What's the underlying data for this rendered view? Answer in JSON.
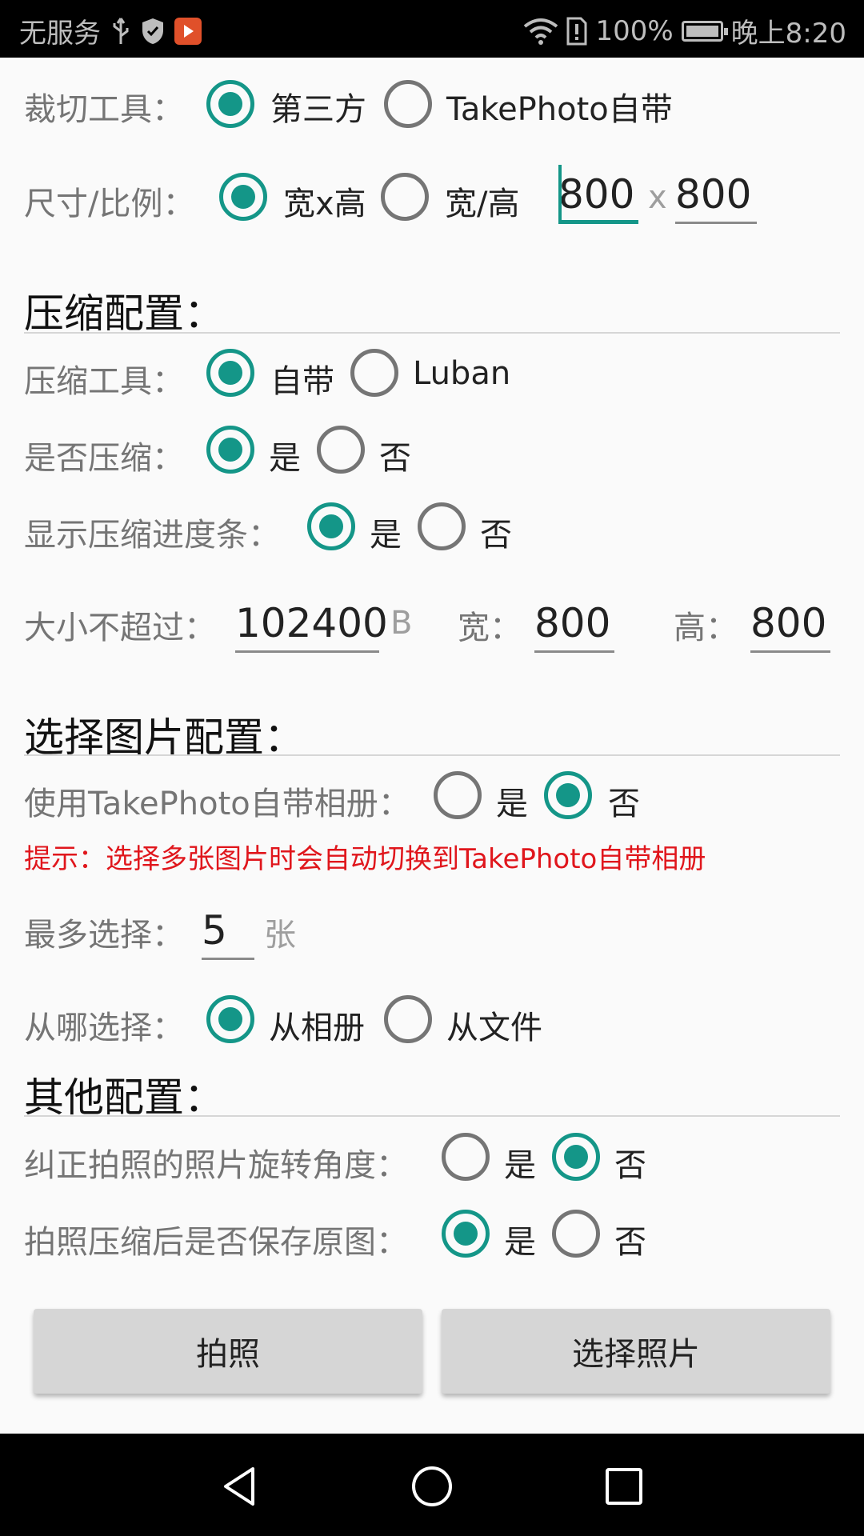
{
  "status_bar": {
    "carrier": "无服务",
    "battery": "100%",
    "battery_level": 1.0,
    "time": "晚上8:20",
    "icons": [
      "usb-icon",
      "shield-icon",
      "app-icon",
      "wifi-icon",
      "sim-alert-icon",
      "battery-icon"
    ]
  },
  "crop": {
    "tool_label": "裁切工具：",
    "tool_options": [
      "第三方",
      "TakePhoto自带"
    ],
    "tool_selected": "第三方",
    "size_label": "尺寸/比例：",
    "size_options": [
      "宽x高",
      "宽/高"
    ],
    "size_selected": "宽x高",
    "width_value": "800",
    "times": "x",
    "height_value": "800"
  },
  "compress": {
    "section_title": "压缩配置：",
    "tool_label": "压缩工具：",
    "tool_options": [
      "自带",
      "Luban"
    ],
    "tool_selected": "自带",
    "enable_label": "是否压缩：",
    "enable_options": [
      "是",
      "否"
    ],
    "enable_selected": "是",
    "progress_label": "显示压缩进度条：",
    "progress_options": [
      "是",
      "否"
    ],
    "progress_selected": "是",
    "max_size_label": "大小不超过：",
    "max_size_value": "102400",
    "max_size_unit": "B",
    "width_label": "宽：",
    "width_value": "800",
    "height_label": "高：",
    "height_value": "800"
  },
  "pick": {
    "section_title": "选择图片配置：",
    "album_label": "使用TakePhoto自带相册：",
    "album_options": [
      "是",
      "否"
    ],
    "album_selected": "否",
    "hint": "提示：选择多张图片时会自动切换到TakePhoto自带相册",
    "max_label": "最多选择：",
    "max_value": "5",
    "max_unit": "张",
    "source_label": "从哪选择：",
    "source_options": [
      "从相册",
      "从文件"
    ],
    "source_selected": "从相册"
  },
  "other": {
    "section_title": "其他配置：",
    "rotate_label": "纠正拍照的照片旋转角度：",
    "rotate_options": [
      "是",
      "否"
    ],
    "rotate_selected": "否",
    "save_label": "拍照压缩后是否保存原图：",
    "save_options": [
      "是",
      "否"
    ],
    "save_selected": "是"
  },
  "actions": {
    "take_photo": "拍照",
    "pick_photo": "选择照片"
  },
  "colors": {
    "accent": "#149688",
    "hint": "#e0161c",
    "button": "#d6d6d6"
  }
}
